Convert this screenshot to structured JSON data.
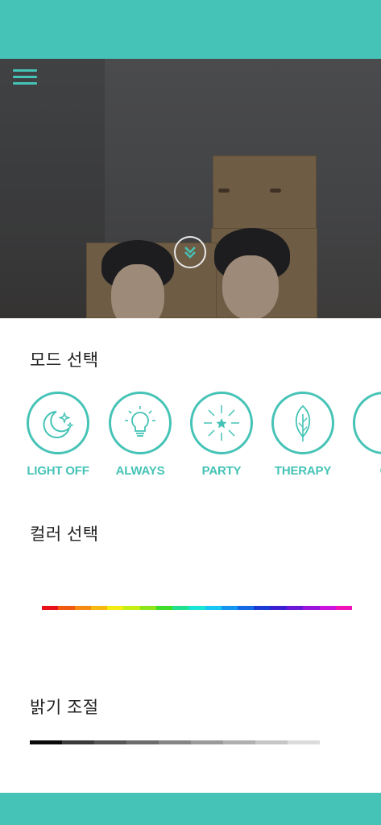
{
  "header": {
    "color": "#45c3b6"
  },
  "hero": {
    "menu_icon": "hamburger-menu-icon",
    "scroll_icon": "double-chevron-down-icon"
  },
  "mode_section": {
    "title": "모드 선택",
    "modes": [
      {
        "label": "LIGHT OFF",
        "icon": "moon-stars-icon"
      },
      {
        "label": "ALWAYS",
        "icon": "lightbulb-icon"
      },
      {
        "label": "PARTY",
        "icon": "sparkle-star-icon"
      },
      {
        "label": "THERAPY",
        "icon": "leaf-icon"
      },
      {
        "label": "C",
        "icon": "partial-mode-icon"
      }
    ]
  },
  "color_section": {
    "title": "컬러 선택",
    "colors": [
      "#e8101b",
      "#ef5a10",
      "#f58a12",
      "#f6b90e",
      "#f3ec13",
      "#c6ee12",
      "#8ee41a",
      "#3fdc2a",
      "#1fe08f",
      "#18e5d6",
      "#17c6f2",
      "#1496ee",
      "#1368e4",
      "#1a3ad6",
      "#3a1ed2",
      "#6a17d8",
      "#9a14de",
      "#cc12dc",
      "#ef12b9"
    ]
  },
  "brightness_section": {
    "title": "밝기 조절",
    "levels": [
      "#0a0a0a",
      "#3a3a3a",
      "#555555",
      "#6c6c6c",
      "#858585",
      "#9a9a9a",
      "#b0b0b0",
      "#c6c6c6",
      "#dcdcdc"
    ]
  },
  "accent_color": "#45c3b6"
}
